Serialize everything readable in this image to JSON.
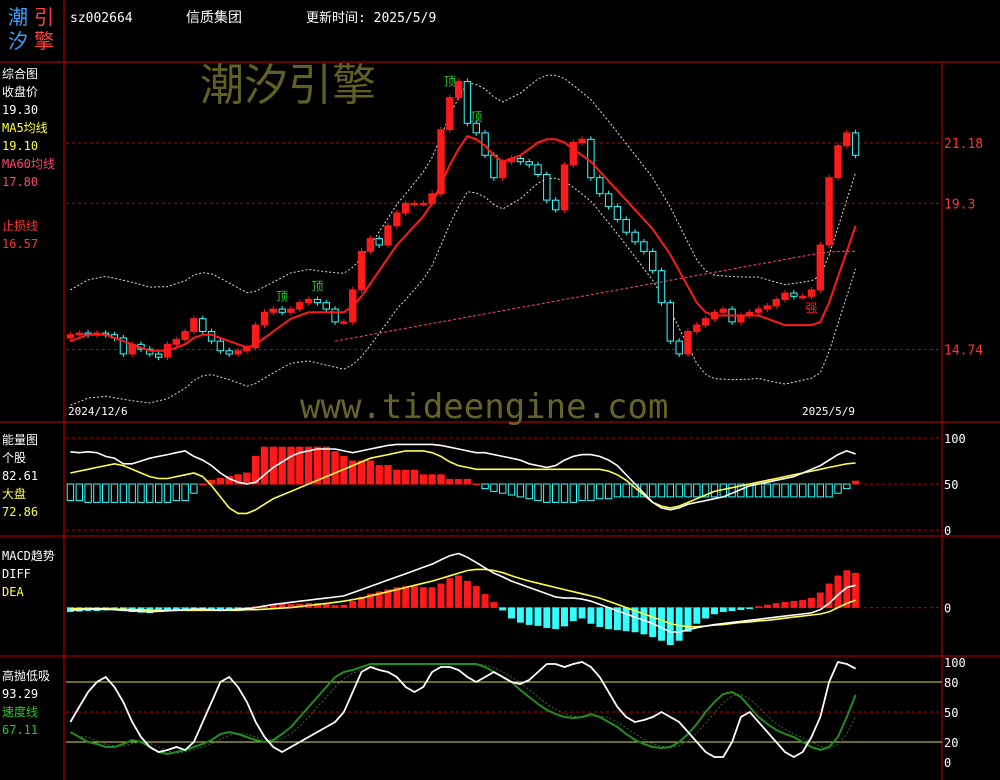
{
  "header": {
    "logo_chars": [
      "潮",
      "汐",
      "引",
      "擎"
    ],
    "code": "sz002664",
    "name": "信质集团",
    "update_label": "更新时间: 2025/5/9"
  },
  "watermark": {
    "logo_text": "潮汐引擎",
    "url": "www.tideengine.com"
  },
  "colors": {
    "up": "#ff1a1a",
    "down": "#33ffff",
    "ma5": "#ffff44",
    "ma60": "#ff4466",
    "frame": "#cc0000",
    "green_line": "#1f8f1f",
    "label_green": "#22cc22"
  },
  "panel_main": {
    "labels": {
      "title": "综合图",
      "close_label": "收盘价",
      "close_value": "19.30",
      "ma5_label": "MA5均线",
      "ma5_value": "19.10",
      "ma60_label": "MA60均线",
      "ma60_value": "17.80",
      "stop_label": "止损线",
      "stop_value": "16.57"
    },
    "axis_labels": [
      "21.18",
      "19.3",
      "14.74"
    ],
    "date_start": "2024/12/6",
    "date_end": "2025/5/9",
    "annotations": [
      "顶",
      "顶",
      "顶",
      "顶",
      "强"
    ]
  },
  "panel_energy": {
    "labels": {
      "title": "能量图",
      "stock_label": "个股",
      "stock_value": "82.61",
      "market_label": "大盘",
      "market_value": "72.86"
    },
    "axis_labels": [
      "100",
      "50",
      "0"
    ]
  },
  "panel_macd": {
    "labels": {
      "title": "MACD趋势",
      "diff_label": "DIFF",
      "dea_label": "DEA"
    },
    "axis_labels": [
      "0"
    ]
  },
  "panel_osc": {
    "labels": {
      "title": "高抛低吸",
      "value": "93.29",
      "speed_label": "速度线",
      "speed_value": "67.11"
    },
    "axis_labels": [
      "100",
      "80",
      "50",
      "20",
      "0"
    ]
  },
  "chart_data": [
    {
      "type": "candlestick",
      "ylim": [
        13.6,
        23.4
      ],
      "ref_lines": [
        21.18,
        19.3,
        14.74
      ],
      "close": [
        15.2,
        15.25,
        15.2,
        15.25,
        15.2,
        15.1,
        14.6,
        14.9,
        14.75,
        14.6,
        14.5,
        14.9,
        15.05,
        15.3,
        15.7,
        15.3,
        15.0,
        14.7,
        14.6,
        14.7,
        14.8,
        15.5,
        15.9,
        16.0,
        15.9,
        16.0,
        16.2,
        16.3,
        16.2,
        16.0,
        15.6,
        15.6,
        16.6,
        17.8,
        18.2,
        18.0,
        18.6,
        19.0,
        19.3,
        19.3,
        19.3,
        19.6,
        21.6,
        22.6,
        23.1,
        21.8,
        21.5,
        20.8,
        20.1,
        20.6,
        20.7,
        20.6,
        20.5,
        20.2,
        19.4,
        19.1,
        20.5,
        21.2,
        21.3,
        20.1,
        19.6,
        19.2,
        18.8,
        18.4,
        18.1,
        17.8,
        17.2,
        16.2,
        15.0,
        14.6,
        15.3,
        15.5,
        15.7,
        15.9,
        16.0,
        15.6,
        15.8,
        15.9,
        16.0,
        16.1,
        16.3,
        16.5,
        16.4,
        16.4,
        16.6,
        18.0,
        20.1,
        21.1,
        21.5,
        20.8
      ],
      "ma5": [
        15.0,
        15.1,
        15.2,
        15.2,
        15.2,
        15.1,
        15.0,
        14.9,
        14.8,
        14.7,
        14.7,
        14.7,
        14.8,
        14.9,
        15.1,
        15.2,
        15.2,
        15.1,
        15.0,
        14.9,
        14.8,
        14.9,
        15.1,
        15.3,
        15.5,
        15.7,
        15.8,
        15.9,
        15.9,
        15.9,
        15.9,
        15.9,
        16.1,
        16.4,
        16.8,
        17.2,
        17.6,
        18.0,
        18.3,
        18.6,
        18.9,
        19.3,
        19.9,
        20.5,
        21.0,
        21.4,
        21.3,
        21.1,
        20.8,
        20.6,
        20.7,
        20.8,
        21.0,
        21.2,
        21.3,
        21.3,
        21.2,
        21.0,
        20.8,
        20.6,
        20.3,
        20.0,
        19.7,
        19.4,
        19.1,
        18.8,
        18.5,
        18.1,
        17.7,
        17.2,
        16.7,
        16.2,
        15.9,
        15.8,
        15.8,
        15.8,
        15.8,
        15.8,
        15.8,
        15.7,
        15.6,
        15.5,
        15.5,
        15.5,
        15.5,
        15.6,
        16.2,
        17.0,
        17.8,
        18.6
      ],
      "ma60": [
        null,
        null,
        null,
        null,
        null,
        null,
        null,
        null,
        null,
        null,
        null,
        null,
        null,
        null,
        null,
        null,
        null,
        null,
        null,
        null,
        null,
        null,
        null,
        null,
        null,
        null,
        null,
        null,
        null,
        null,
        15.0,
        15.05,
        15.1,
        15.15,
        15.2,
        15.25,
        15.3,
        15.35,
        15.4,
        15.45,
        15.5,
        15.55,
        15.6,
        15.65,
        15.7,
        15.75,
        15.8,
        15.85,
        15.9,
        15.95,
        16.0,
        16.05,
        16.1,
        16.15,
        16.2,
        16.25,
        16.3,
        16.35,
        16.4,
        16.45,
        16.5,
        16.55,
        16.6,
        16.65,
        16.7,
        16.75,
        16.8,
        16.85,
        16.9,
        16.95,
        17.0,
        17.05,
        17.1,
        17.15,
        17.2,
        17.25,
        17.3,
        17.35,
        17.4,
        17.45,
        17.5,
        17.55,
        17.6,
        17.65,
        17.7,
        17.75,
        17.78,
        17.8,
        17.8,
        17.8
      ]
    },
    {
      "type": "bar",
      "ylim": [
        0,
        100
      ],
      "stock": [
        85,
        84,
        85,
        84,
        80,
        78,
        72,
        72,
        75,
        78,
        80,
        82,
        84,
        86,
        80,
        76,
        70,
        62,
        56,
        52,
        50,
        52,
        60,
        68,
        74,
        80,
        84,
        86,
        88,
        88,
        88,
        86,
        84,
        86,
        88,
        90,
        92,
        93,
        93,
        93,
        93,
        93,
        92,
        90,
        88,
        86,
        84,
        84,
        82,
        80,
        78,
        76,
        72,
        70,
        68,
        70,
        76,
        80,
        82,
        82,
        80,
        76,
        70,
        60,
        50,
        40,
        30,
        24,
        22,
        24,
        28,
        30,
        32,
        34,
        36,
        40,
        44,
        48,
        50,
        52,
        54,
        56,
        58,
        62,
        66,
        70,
        76,
        82,
        86,
        82.61
      ],
      "market": [
        62,
        64,
        66,
        68,
        70,
        72,
        70,
        66,
        62,
        58,
        56,
        56,
        58,
        60,
        62,
        58,
        48,
        36,
        24,
        18,
        18,
        22,
        28,
        34,
        38,
        42,
        46,
        50,
        54,
        58,
        62,
        66,
        70,
        74,
        78,
        80,
        82,
        84,
        86,
        86,
        86,
        84,
        80,
        74,
        70,
        68,
        66,
        66,
        66,
        66,
        66,
        66,
        66,
        66,
        66,
        66,
        66,
        66,
        66,
        66,
        66,
        64,
        60,
        54,
        46,
        38,
        30,
        26,
        24,
        26,
        30,
        34,
        38,
        42,
        44,
        46,
        48,
        50,
        52,
        54,
        56,
        58,
        60,
        62,
        64,
        66,
        68,
        70,
        72,
        72.86
      ],
      "histogram": [
        -18,
        -18,
        -20,
        -20,
        -20,
        -20,
        -20,
        -20,
        -20,
        -20,
        -20,
        -20,
        -18,
        -18,
        -10,
        0,
        4,
        6,
        8,
        10,
        12,
        30,
        40,
        40,
        40,
        40,
        40,
        40,
        40,
        40,
        35,
        30,
        25,
        25,
        25,
        20,
        20,
        15,
        15,
        15,
        10,
        10,
        10,
        5,
        5,
        5,
        0,
        -5,
        -8,
        -10,
        -12,
        -14,
        -16,
        -18,
        -20,
        -20,
        -20,
        -20,
        -18,
        -18,
        -16,
        -16,
        -14,
        -14,
        -14,
        -14,
        -14,
        -14,
        -14,
        -14,
        -14,
        -14,
        -14,
        -14,
        -14,
        -14,
        -14,
        -14,
        -14,
        -14,
        -14,
        -14,
        -14,
        -14,
        -14,
        -14,
        -14,
        -10,
        -5,
        3
      ]
    },
    {
      "type": "bar",
      "ylim": [
        -0.8,
        1.2
      ],
      "macd_histogram": [
        -0.08,
        -0.07,
        -0.06,
        -0.06,
        -0.05,
        -0.04,
        -0.06,
        -0.08,
        -0.09,
        -0.1,
        -0.08,
        -0.06,
        -0.04,
        -0.02,
        -0.02,
        -0.03,
        -0.05,
        -0.06,
        -0.05,
        -0.04,
        -0.02,
        0.02,
        0.04,
        0.05,
        0.06,
        0.06,
        0.07,
        0.08,
        0.08,
        0.06,
        0.04,
        0.05,
        0.12,
        0.2,
        0.26,
        0.3,
        0.34,
        0.38,
        0.4,
        0.4,
        0.38,
        0.38,
        0.45,
        0.55,
        0.6,
        0.5,
        0.4,
        0.25,
        0.1,
        -0.05,
        -0.2,
        -0.28,
        -0.32,
        -0.34,
        -0.38,
        -0.4,
        -0.35,
        -0.25,
        -0.2,
        -0.3,
        -0.36,
        -0.4,
        -0.42,
        -0.44,
        -0.46,
        -0.5,
        -0.55,
        -0.62,
        -0.7,
        -0.62,
        -0.45,
        -0.3,
        -0.2,
        -0.12,
        -0.08,
        -0.06,
        -0.04,
        -0.02,
        0.02,
        0.05,
        0.08,
        0.1,
        0.12,
        0.14,
        0.18,
        0.28,
        0.45,
        0.6,
        0.7,
        0.65
      ],
      "diff": [
        -0.05,
        -0.04,
        -0.03,
        -0.03,
        -0.03,
        -0.04,
        -0.05,
        -0.06,
        -0.07,
        -0.08,
        -0.07,
        -0.06,
        -0.05,
        -0.04,
        -0.03,
        -0.03,
        -0.04,
        -0.05,
        -0.04,
        -0.03,
        -0.02,
        0.0,
        0.03,
        0.06,
        0.08,
        0.1,
        0.12,
        0.14,
        0.16,
        0.18,
        0.2,
        0.22,
        0.28,
        0.34,
        0.4,
        0.46,
        0.52,
        0.58,
        0.64,
        0.7,
        0.76,
        0.82,
        0.9,
        0.98,
        1.02,
        0.95,
        0.85,
        0.75,
        0.65,
        0.58,
        0.5,
        0.44,
        0.38,
        0.32,
        0.26,
        0.2,
        0.18,
        0.18,
        0.16,
        0.12,
        0.06,
        0.0,
        -0.06,
        -0.12,
        -0.18,
        -0.24,
        -0.3,
        -0.38,
        -0.46,
        -0.46,
        -0.42,
        -0.38,
        -0.35,
        -0.32,
        -0.3,
        -0.28,
        -0.26,
        -0.24,
        -0.22,
        -0.2,
        -0.18,
        -0.16,
        -0.14,
        -0.12,
        -0.1,
        -0.04,
        0.08,
        0.24,
        0.38,
        0.42
      ],
      "dea": [
        -0.02,
        -0.02,
        -0.02,
        -0.02,
        -0.02,
        -0.03,
        -0.03,
        -0.04,
        -0.04,
        -0.05,
        -0.05,
        -0.05,
        -0.05,
        -0.05,
        -0.05,
        -0.05,
        -0.05,
        -0.05,
        -0.05,
        -0.05,
        -0.04,
        -0.04,
        -0.03,
        -0.02,
        -0.01,
        0.0,
        0.02,
        0.04,
        0.06,
        0.08,
        0.1,
        0.12,
        0.15,
        0.18,
        0.22,
        0.26,
        0.3,
        0.34,
        0.38,
        0.42,
        0.46,
        0.5,
        0.55,
        0.6,
        0.65,
        0.7,
        0.72,
        0.72,
        0.7,
        0.66,
        0.6,
        0.55,
        0.5,
        0.46,
        0.42,
        0.38,
        0.34,
        0.3,
        0.26,
        0.22,
        0.18,
        0.12,
        0.06,
        0.0,
        -0.06,
        -0.12,
        -0.18,
        -0.24,
        -0.3,
        -0.34,
        -0.36,
        -0.36,
        -0.35,
        -0.33,
        -0.32,
        -0.3,
        -0.28,
        -0.27,
        -0.25,
        -0.24,
        -0.22,
        -0.2,
        -0.18,
        -0.16,
        -0.14,
        -0.12,
        -0.08,
        0.0,
        0.08,
        0.14
      ]
    },
    {
      "type": "line",
      "ylim": [
        0,
        100
      ],
      "ref_lines": [
        80,
        50,
        20
      ],
      "value": [
        40,
        55,
        70,
        80,
        85,
        75,
        60,
        40,
        25,
        15,
        10,
        12,
        15,
        12,
        20,
        40,
        60,
        80,
        85,
        75,
        60,
        40,
        25,
        15,
        10,
        15,
        20,
        25,
        30,
        35,
        40,
        50,
        70,
        90,
        95,
        92,
        90,
        85,
        75,
        70,
        75,
        90,
        95,
        95,
        92,
        85,
        80,
        85,
        90,
        85,
        80,
        78,
        82,
        90,
        98,
        98,
        95,
        98,
        100,
        95,
        85,
        70,
        55,
        45,
        40,
        42,
        45,
        50,
        45,
        40,
        30,
        20,
        10,
        5,
        5,
        20,
        45,
        50,
        40,
        30,
        20,
        10,
        5,
        10,
        25,
        45,
        80,
        100,
        98,
        93.29
      ],
      "speed": [
        30,
        25,
        20,
        18,
        15,
        15,
        18,
        22,
        20,
        15,
        10,
        8,
        10,
        12,
        15,
        18,
        22,
        28,
        30,
        28,
        25,
        22,
        20,
        22,
        28,
        35,
        45,
        55,
        65,
        75,
        85,
        90,
        92,
        95,
        98,
        98,
        98,
        98,
        98,
        98,
        98,
        98,
        98,
        98,
        98,
        98,
        98,
        95,
        90,
        85,
        80,
        72,
        65,
        58,
        52,
        48,
        45,
        44,
        45,
        48,
        45,
        40,
        35,
        28,
        22,
        18,
        15,
        14,
        15,
        20,
        28,
        38,
        50,
        60,
        68,
        70,
        65,
        55,
        45,
        38,
        32,
        28,
        25,
        20,
        15,
        12,
        15,
        25,
        45,
        67.11
      ]
    }
  ]
}
